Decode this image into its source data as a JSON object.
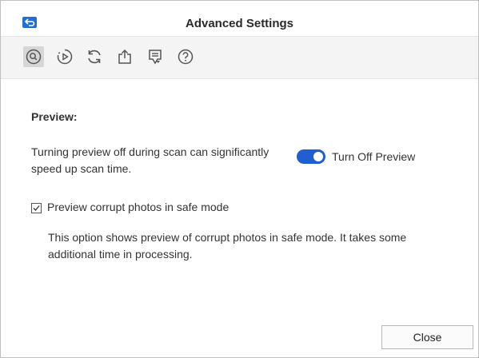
{
  "window": {
    "title": "Advanced Settings"
  },
  "toolbar": {
    "items": [
      {
        "icon": "scan-icon",
        "active": true
      },
      {
        "icon": "preview-icon",
        "active": false
      },
      {
        "icon": "update-icon",
        "active": false
      },
      {
        "icon": "export-icon",
        "active": false
      },
      {
        "icon": "feedback-icon",
        "active": false
      },
      {
        "icon": "help-icon",
        "active": false
      }
    ]
  },
  "preview": {
    "heading": "Preview:",
    "description": "Turning preview off during scan can significantly speed up scan time.",
    "toggle_label": "Turn Off Preview",
    "toggle_on": true,
    "safe_mode_checked": true,
    "safe_mode_label": "Preview corrupt photos in safe mode",
    "safe_mode_note": "This option shows preview of corrupt photos in safe mode. It takes some additional time in processing."
  },
  "footer": {
    "close_label": "Close"
  },
  "colors": {
    "accent": "#1f5fcf",
    "toolbar_bg": "#f4f4f4",
    "active_tool_bg": "#d6d6d6"
  }
}
